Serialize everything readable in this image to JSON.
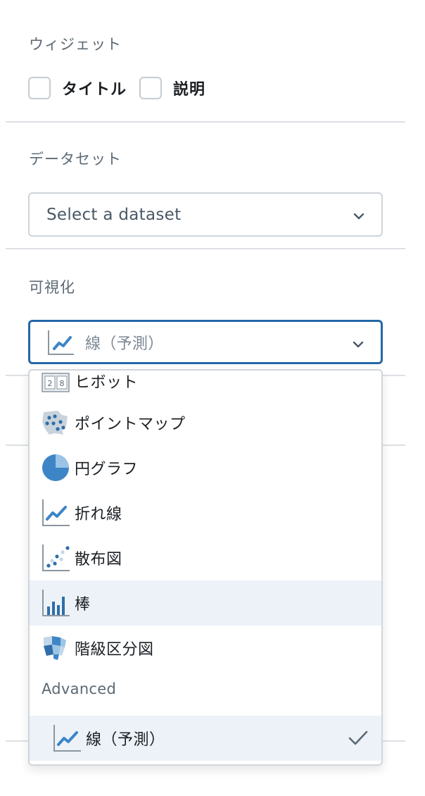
{
  "widget": {
    "label": "ウィジェット",
    "options": [
      {
        "label": "タイトル",
        "checked": false
      },
      {
        "label": "説明",
        "checked": false
      }
    ]
  },
  "dataset": {
    "label": "データセット",
    "placeholder": "Select a dataset"
  },
  "visualization": {
    "label": "可視化",
    "selected": "線（予測）",
    "menu": {
      "items": [
        {
          "label": "ヒボット",
          "icon": "pivot-table-icon"
        },
        {
          "label": "ポイントマップ",
          "icon": "point-map-icon"
        },
        {
          "label": "円グラフ",
          "icon": "pie-chart-icon"
        },
        {
          "label": "折れ線",
          "icon": "line-chart-icon"
        },
        {
          "label": "散布図",
          "icon": "scatter-plot-icon"
        },
        {
          "label": "棒",
          "icon": "bar-chart-icon",
          "hovered": true
        },
        {
          "label": "階級区分図",
          "icon": "choropleth-map-icon"
        }
      ],
      "advanced_header": "Advanced",
      "advanced_items": [
        {
          "label": "線（予測）",
          "icon": "forecast-line-icon",
          "selected": true
        }
      ]
    }
  },
  "colors": {
    "accent": "#2567a6",
    "icon_blue": "#3d85c6",
    "highlight": "#edf2f8"
  }
}
